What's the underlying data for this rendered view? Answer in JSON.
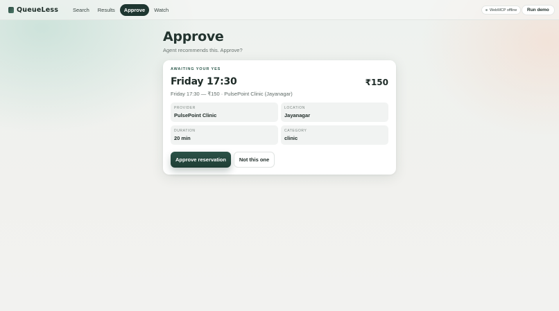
{
  "brand": {
    "name": "QueueLess",
    "icon": "queueless-logo-icon"
  },
  "nav": {
    "items": [
      {
        "label": "Search",
        "active": false
      },
      {
        "label": "Results",
        "active": false
      },
      {
        "label": "Approve",
        "active": true
      },
      {
        "label": "Watch",
        "active": false
      }
    ]
  },
  "header": {
    "status_label": "WebMCP offline",
    "run_demo_label": "Run demo"
  },
  "page": {
    "title": "Approve",
    "subtitle": "Agent recommends this. Approve?"
  },
  "card": {
    "eyebrow": "AWAITING YOUR YES",
    "time": "Friday 17:30",
    "price": "₹150",
    "summary": "Friday 17:30 — ₹150 · PulsePoint Clinic (Jayanagar)",
    "details": [
      {
        "label": "PROVIDER",
        "value": "PulsePoint Clinic"
      },
      {
        "label": "LOCATION",
        "value": "Jayanagar"
      },
      {
        "label": "DURATION",
        "value": "20 min"
      },
      {
        "label": "CATEGORY",
        "value": "clinic"
      }
    ],
    "approve_label": "Approve reservation",
    "reject_label": "Not this one"
  },
  "colors": {
    "accent": "#1e3630",
    "button_primary": "#244a40",
    "eyebrow": "#2e5a4d"
  }
}
